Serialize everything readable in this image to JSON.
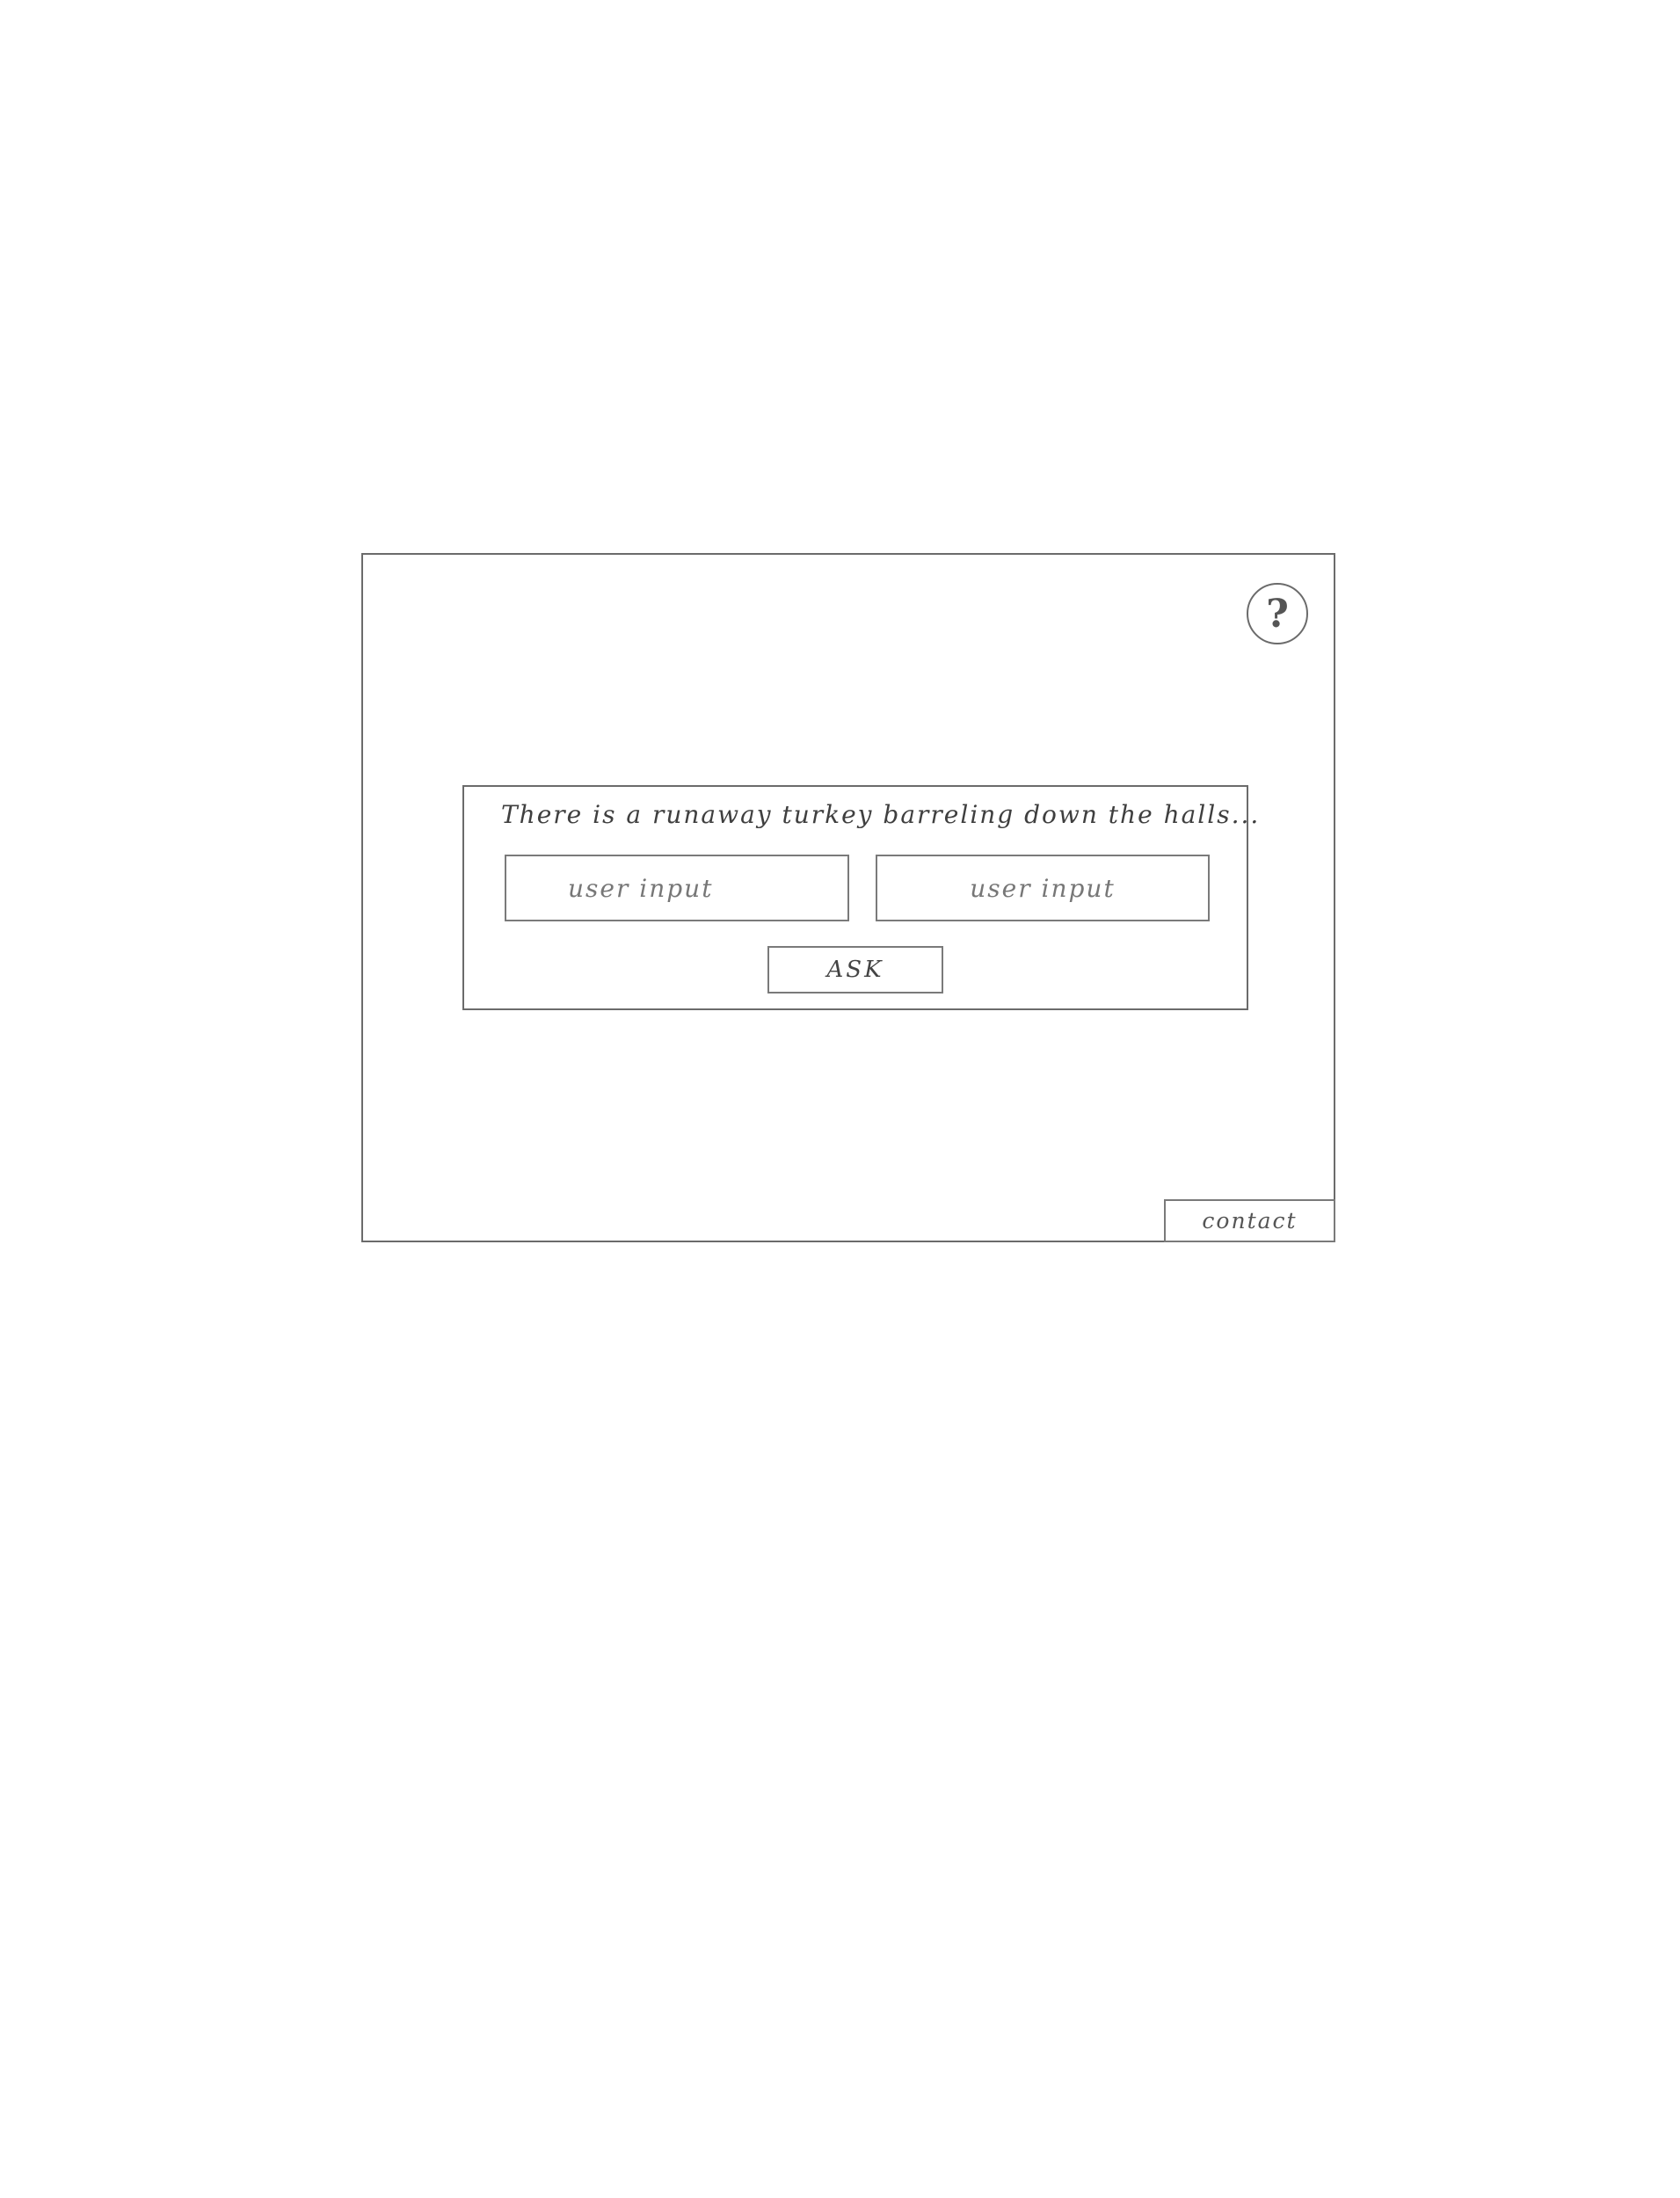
{
  "help": {
    "label": "?",
    "icon": "question-mark-icon"
  },
  "prompt": {
    "text": "There is a runaway turkey barreling down the halls..."
  },
  "inputs": [
    {
      "placeholder": "user input",
      "value": ""
    },
    {
      "placeholder": "user input",
      "value": ""
    }
  ],
  "ask_button": {
    "label": "ASK"
  },
  "contact_button": {
    "label": "contact"
  }
}
